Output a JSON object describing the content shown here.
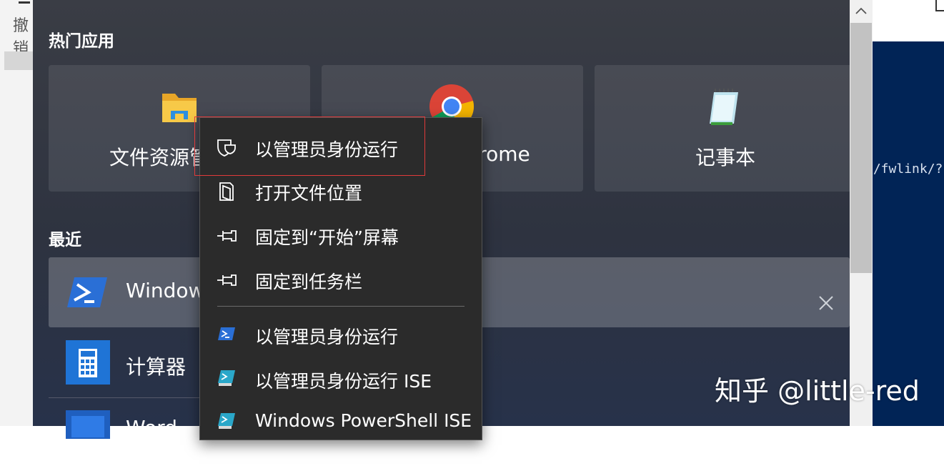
{
  "background_app": {
    "undo_label": "撤销"
  },
  "background_browser": {
    "url_fragment": "n/fwlink/?"
  },
  "start_menu": {
    "popular_title": "热门应用",
    "tiles": [
      {
        "label": "文件资源管理器",
        "icon": "file-explorer-icon"
      },
      {
        "label": "Google Chrome",
        "icon": "chrome-icon"
      },
      {
        "label": "记事本",
        "icon": "notepad-icon"
      }
    ],
    "recent_title": "最近",
    "recent": [
      {
        "label": "Windows PowerShell",
        "icon": "powershell-icon"
      },
      {
        "label": "计算器",
        "icon": "calculator-icon"
      },
      {
        "label": "Word",
        "icon": "word-icon"
      }
    ]
  },
  "context_menu": {
    "items": [
      {
        "label": "以管理员身份运行",
        "icon": "shield-icon"
      },
      {
        "label": "打开文件位置",
        "icon": "folder-location-icon"
      },
      {
        "label": "固定到“开始”屏幕",
        "icon": "pin-icon"
      },
      {
        "label": "固定到任务栏",
        "icon": "pin-icon"
      },
      {
        "label": "以管理员身份运行",
        "icon": "powershell-icon"
      },
      {
        "label": "以管理员身份运行 ISE",
        "icon": "powershell-ise-icon"
      },
      {
        "label": "Windows PowerShell ISE",
        "icon": "powershell-ise-icon"
      }
    ]
  },
  "watermark": "知乎 @little-red",
  "colors": {
    "highlight_border": "#e03a3a",
    "menu_bg": "#2b2b2b",
    "powershell_blue": "#2a6fd6",
    "terminal_bg": "#012456"
  }
}
